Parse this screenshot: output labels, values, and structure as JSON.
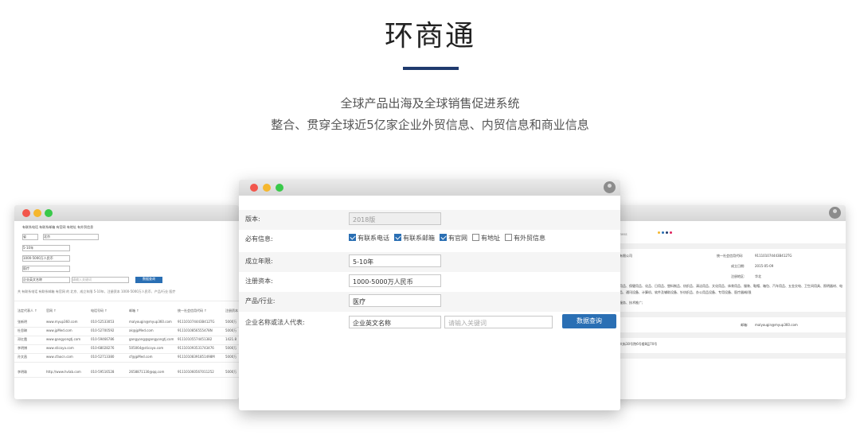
{
  "header": {
    "title": "环商通",
    "subtitle1": "全球产品出海及全球销售促进系统",
    "subtitle2": "整合、贯穿全球近5亿家企业外贸信息、内贸信息和商业信息"
  },
  "colors": {
    "accent": "#1f3a6e",
    "button": "#2a6fb4"
  },
  "form": {
    "version_label": "版本:",
    "version_value": "2018版",
    "required_label": "必有信息:",
    "checks": [
      {
        "label": "有联系电话",
        "checked": true
      },
      {
        "label": "有联系邮箱",
        "checked": true
      },
      {
        "label": "有官网",
        "checked": true
      },
      {
        "label": "有地址",
        "checked": false
      },
      {
        "label": "有外贸信息",
        "checked": false
      }
    ],
    "years_label": "成立年限:",
    "years_value": "5-10年",
    "capital_label": "注册资本:",
    "capital_value": "1000-5000万人民币",
    "industry_label": "产品/行业:",
    "industry_value": "医疗",
    "company_label": "企业名称或法人代表:",
    "company_select": "企业英文名称",
    "keyword_placeholder": "请输入关键词",
    "search_button": "数据查询"
  },
  "left_window": {
    "checks": [
      "有联系电话",
      "有联系邮箱",
      "有官网",
      "有地址",
      "有外贸信息"
    ],
    "fields": [
      "省",
      "北京",
      "5-10年",
      "1000-5000万人民币",
      "医疗"
    ],
    "company_select": "企业英文名称",
    "keyword_placeholder": "请输入关键词",
    "search_button": "数据查询",
    "note": "共 有联系电话 有联系邮箱 有官网 的 北京、成立年限 5-10年、注册资本 1000-5000万人民币、产品/行业 医疗",
    "columns": [
      "法定代表人 ↑",
      "官网 ↑",
      "电话号码 ↑",
      "邮箱 ↑",
      "统一社会信用代码 ↑",
      "注册资本"
    ],
    "rows": [
      [
        "张新明",
        "www.myup360.com",
        "010-52533053",
        "malyougin@myup360.com",
        "911101074443B412TG",
        "5000万"
      ],
      [
        "杜思琳",
        "www.jpMed.com",
        "010-52700592",
        "ak@jpMed.com",
        "9111010856555478N",
        "5000万"
      ],
      [
        "邓红霞",
        "www.gangyongtj.com",
        "010-59466786",
        "gangyong@gangyongtj.com",
        "91110105574451382",
        "1421.8"
      ],
      [
        "李明博",
        "www.sticoya.com",
        "010-68028276",
        "505064@sticoya.com",
        "911101093531743476",
        "5000万"
      ],
      [
        "孙文昌",
        "www.cfaocn.com",
        "010-52713380",
        "cf@jpMed.com",
        "91110108391851498M",
        "5000万"
      ],
      [
        "李明珠",
        "http://www.hvlab.com",
        "010-59516528",
        "2658871130@qq.com",
        "911101060567011252",
        "5000万"
      ]
    ]
  },
  "right_window": {
    "brand_word": "Business",
    "rows": [
      [
        "统一社会信用代码:",
        "911101074443B412TG"
      ],
      [
        "成立日期:",
        "2015-05-09"
      ],
      [
        "注册地区:",
        "华北"
      ],
      [
        "邮箱:",
        "malyougin@myup360.com"
      ]
    ],
    "company_fragment": "健康有限公司",
    "products": "化工用品、保健用品、化品、日用品、塑料制品、纺织品、清洁用品、文化用品、体育用品、服装、鞋帽、箱包、汽车用品、五金交电、卫生间用具、照明器材、电子产品、通讯设备、计算机、软件及辅助设备、针纺织品、办公用品设备、专用设备、医疗器械(限",
    "tech_service": "技术服务、技术推广;",
    "address": "定兴大街30号院6号楼8层70号"
  }
}
